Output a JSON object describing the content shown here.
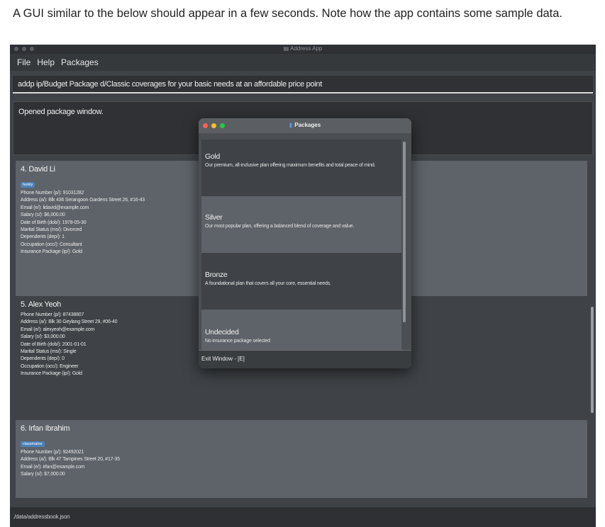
{
  "caption": "A GUI similar to the below should appear in a few seconds. Note how the app contains some sample data.",
  "app": {
    "title": "Address App",
    "menu": [
      "File",
      "Help",
      "Packages"
    ],
    "command": "addp ip/Budget Package d/Classic coverages for your basic needs at an affordable price point",
    "result": "Opened package window.",
    "status": "./data/addressbook.json"
  },
  "persons": [
    {
      "name": "4. David Li",
      "tag": "family",
      "fields": [
        "Phone Number (p/): 91031282",
        "Address (a/): Blk 436 Serangoon Gardens Street 26, #16-43",
        "Email (e/): lidavid@example.com",
        "Salary (s/): $6,000.00",
        "Date of Birth (dob/): 1978-05-30",
        "Marital Status (ms/): Divorced",
        "Dependents (dep/): 1",
        "Occupation (occ/): Consultant",
        "Insurance Package (ip/): Gold"
      ]
    },
    {
      "name": "5. Alex Yeoh",
      "tag": "",
      "fields": [
        "Phone Number (p/): 87438807",
        "Address (a/): Blk 30 Geylang Street 29, #06-40",
        "Email (e/): alexyeoh@example.com",
        "Salary (s/): $3,000.00",
        "Date of Birth (dob/): 2001-01-01",
        "Marital Status (ms/): Single",
        "Dependents (dep/): 0",
        "Occupation (occ/): Engineer",
        "Insurance Package (ip/): Gold"
      ]
    },
    {
      "name": "6. Irfan Ibrahim",
      "tag": "classmates",
      "fields": [
        "Phone Number (p/): 92492021",
        "Address (a/): Blk 47 Tampines Street 20, #17-35",
        "Email (e/): irfan@example.com",
        "Salary (s/): $7,000.00"
      ]
    }
  ],
  "packages_window": {
    "title": "Packages",
    "items": [
      {
        "name": "Gold",
        "desc": "Our premium, all-inclusive plan offering maximum benefits and total peace of mind."
      },
      {
        "name": "Silver",
        "desc": "Our most popular plan, offering a balanced blend of coverage and value."
      },
      {
        "name": "Bronze",
        "desc": "A foundational plan that covers all your core, essential needs."
      },
      {
        "name": "Undecided",
        "desc": "No insurance package selected"
      }
    ],
    "footer": "Exit Window - [E]"
  },
  "colors": {
    "close": "#fe5f57",
    "minimize": "#febc2e",
    "zoom": "#28c840",
    "tag": "#4a82b8"
  }
}
